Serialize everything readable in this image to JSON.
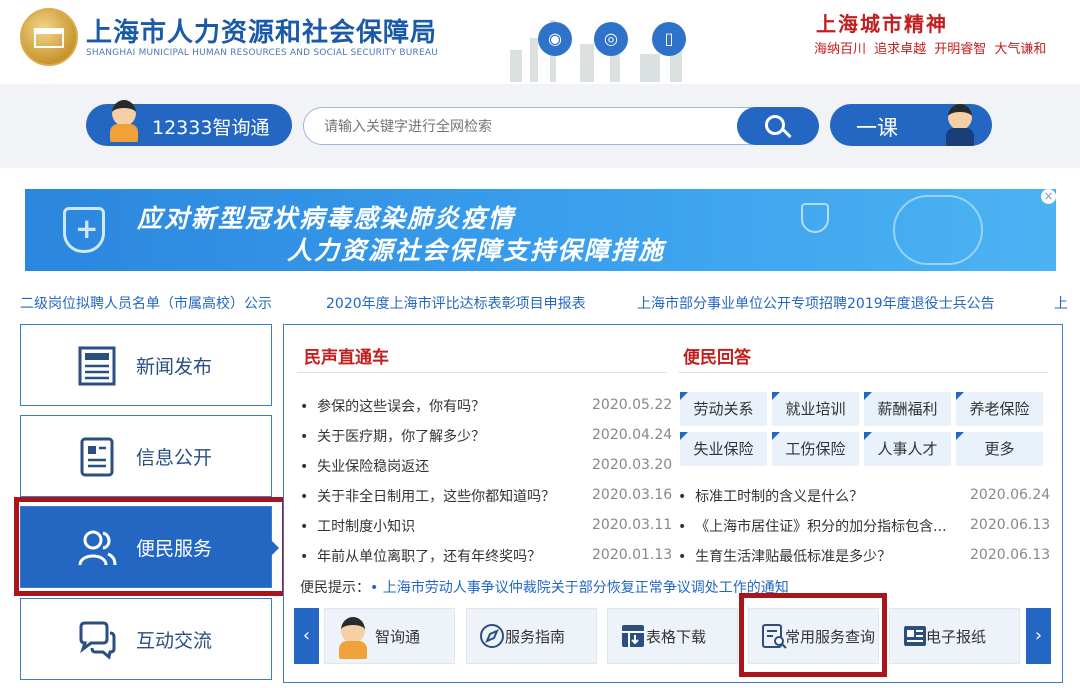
{
  "header": {
    "title": "上海市人力资源和社会保障局",
    "subtitle": "SHANGHAI MUNICIPAL HUMAN RESOURCES AND SOCIAL SECURITY BUREAU",
    "spirit_title": "上海城市精神",
    "spirit_words": "海纳百川 追求卓越 开明睿智 大气谦和"
  },
  "search": {
    "zhixun_label": "12333智询通",
    "placeholder": "请输入关键字进行全网检索",
    "yike_label": "一课"
  },
  "banner": {
    "line1": "应对新型冠状病毒感染肺炎疫情",
    "line2": "人力资源社会保障支持保障措施",
    "close": "×"
  },
  "ticker": [
    "二级岗位拟聘人员名单（市属高校）公示",
    "2020年度上海市评比达标表彰项目申报表",
    "上海市部分事业单位公开专项招聘2019年度退役士兵公告",
    "上"
  ],
  "nav": [
    {
      "label": "新闻发布"
    },
    {
      "label": "信息公开"
    },
    {
      "label": "便民服务"
    },
    {
      "label": "互动交流"
    }
  ],
  "sections": {
    "left_title": "民声直通车",
    "right_title": "便民回答"
  },
  "news": [
    {
      "title": "参保的这些误会，你有吗？",
      "date": "2020.05.22"
    },
    {
      "title": "关于医疗期，你了解多少？",
      "date": "2020.04.24"
    },
    {
      "title": "失业保险稳岗返还",
      "date": "2020.03.20"
    },
    {
      "title": "关于非全日制用工，这些你都知道吗？",
      "date": "2020.03.16"
    },
    {
      "title": "工时制度小知识",
      "date": "2020.03.11"
    },
    {
      "title": "年前从单位离职了，还有年终奖吗？",
      "date": "2020.01.13"
    }
  ],
  "tags": [
    "劳动关系",
    "就业培训",
    "薪酬福利",
    "养老保险",
    "失业保险",
    "工伤保险",
    "人事人才",
    "更多"
  ],
  "answers": [
    {
      "title": "标准工时制的含义是什么？",
      "date": "2020.06.24"
    },
    {
      "title": "《上海市居住证》积分的加分指标包含...",
      "date": "2020.06.13"
    },
    {
      "title": "生育生活津贴最低标准是多少？",
      "date": "2020.06.13"
    }
  ],
  "tip": {
    "label": "便民提示：",
    "link": "• 上海市劳动人事争议仲裁院关于部分恢复正常争议调处工作的通知"
  },
  "tools": [
    {
      "label": "智询通",
      "icon": "avatar-icon"
    },
    {
      "label": "服务指南",
      "icon": "compass-icon"
    },
    {
      "label": "表格下载",
      "icon": "table-download-icon"
    },
    {
      "label": "常用服务查询",
      "icon": "query-icon"
    },
    {
      "label": "电子报纸",
      "icon": "newspaper-icon"
    }
  ],
  "arrows": {
    "prev": "‹",
    "next": "›"
  },
  "colors": {
    "primary": "#2367c3",
    "accent_red": "#c21e1e",
    "highlight": "#a8161b"
  }
}
